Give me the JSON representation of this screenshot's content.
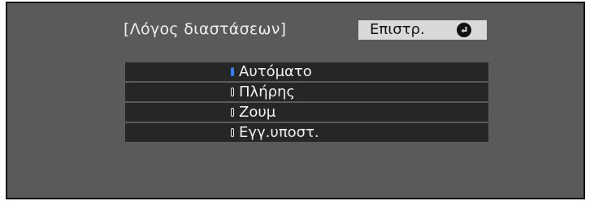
{
  "dialog": {
    "title": "[Λόγος διαστάσεων]",
    "back_label": "Επιστρ.",
    "back_icon": "enter-circle-icon"
  },
  "menu": {
    "items": [
      {
        "label": "Αυτόματο",
        "selected": true
      },
      {
        "label": "Πλήρης",
        "selected": false
      },
      {
        "label": "Ζουμ",
        "selected": false
      },
      {
        "label": "Εγγ.υποστ.",
        "selected": false
      }
    ]
  },
  "colors": {
    "background": "#5a5a5a",
    "item_background": "#262626",
    "button_background": "#d9d9d9",
    "selected_indicator": "#2f7fff"
  }
}
